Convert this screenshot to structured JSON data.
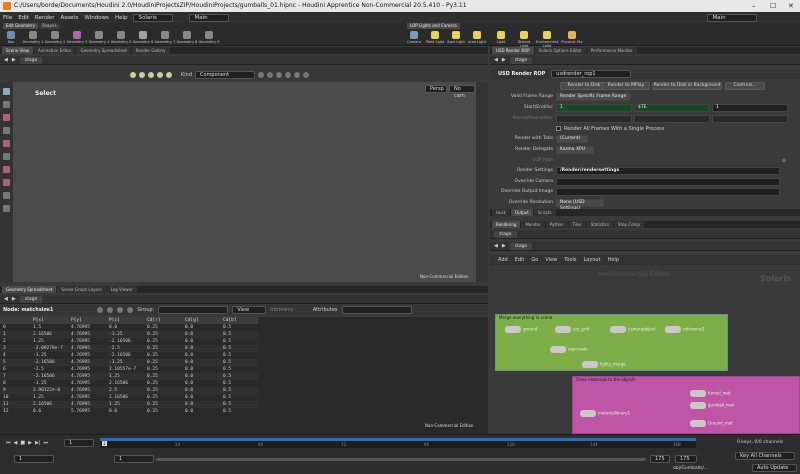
{
  "window": {
    "title": "C:/Users/borde/Documents/Houdini 2.0/HoudiniProjectsZIP/HoudiniProjects/gumballs_01.hipnc - Houdini Apprentice Non-Commercial 20.5.410 - Py3.11"
  },
  "menu": {
    "items": [
      "File",
      "Edit",
      "Render",
      "Assets",
      "Windows",
      "Help"
    ],
    "desktop": "Solaris",
    "context": "Main",
    "right_context": "Main"
  },
  "shelf": {
    "left_tabs": [
      "Edit Geometry",
      "Shapes"
    ],
    "tools": [
      "Box",
      "Geometry 1",
      "Geometry 2",
      "Geometry 3",
      "Geometry 4",
      "Geometry 5",
      "Geometry 6",
      "Geometry 7",
      "Geometry 8",
      "Geometry 9"
    ],
    "right_tabs": [
      "LOP Lights and Camera"
    ],
    "right_tools": [
      "Camera",
      "Point Light",
      "Spot Light",
      "Area Light",
      "Light",
      "Distant Light",
      "Environment Light",
      "Physical Sky"
    ]
  },
  "top_tabs": [
    "Scene View",
    "Animation Editor",
    "Geometry Spreadsheet",
    "Render Gallery"
  ],
  "right_top_tabs": [
    "USD Render ROP",
    "Solaris Options Editor",
    "Performance Monitor"
  ],
  "stage": "stage",
  "viewport": {
    "kind_label": "Kind",
    "kind_value": "Component",
    "select_label": "Select",
    "persp": "Persp",
    "cam": "No cam",
    "watermark": "Non-Commercial Edition"
  },
  "spreadsheet": {
    "tabs": [
      "Geometry Spreadsheet",
      "Scene Graph Layers",
      "Log Viewer"
    ],
    "node_label": "Node: matchsize1",
    "group_label": "Group:",
    "view_label": "View",
    "intrinsics": "Intrinsics",
    "attributes": "Attributes",
    "columns": [
      "",
      "P[x]",
      "P[y]",
      "P[z]",
      "Cd[r]",
      "Cd[g]",
      "Cd[b]"
    ],
    "rows": [
      [
        "0",
        "1.5",
        "4.76995",
        "0.0",
        "0.25",
        "0.0",
        "0.5"
      ],
      [
        "1",
        "2.16506",
        "4.76995",
        "-1.25",
        "0.25",
        "0.0",
        "0.5"
      ],
      [
        "2",
        "1.25",
        "4.76995",
        "-2.16506",
        "0.25",
        "0.0",
        "0.5"
      ],
      [
        "3",
        "-2.09278e-7",
        "4.76995",
        "-2.5",
        "0.25",
        "0.0",
        "0.5"
      ],
      [
        "4",
        "-1.25",
        "4.76995",
        "-2.16506",
        "0.25",
        "0.0",
        "0.5"
      ],
      [
        "5",
        "-2.16506",
        "4.76995",
        "-1.25",
        "0.25",
        "0.0",
        "0.5"
      ],
      [
        "6",
        "-2.5",
        "4.76995",
        "2.18557e-7",
        "0.25",
        "0.0",
        "0.5"
      ],
      [
        "7",
        "-2.16506",
        "4.76995",
        "1.25",
        "0.25",
        "0.0",
        "0.5"
      ],
      [
        "8",
        "-1.25",
        "4.76995",
        "2.16506",
        "0.25",
        "0.0",
        "0.5"
      ],
      [
        "9",
        "2.98122e-8",
        "4.76995",
        "2.5",
        "0.25",
        "0.0",
        "0.5"
      ],
      [
        "10",
        "1.25",
        "4.76995",
        "2.16506",
        "0.25",
        "0.0",
        "0.5"
      ],
      [
        "11",
        "2.16506",
        "4.76995",
        "1.25",
        "0.25",
        "0.0",
        "0.5"
      ],
      [
        "12",
        "0.6",
        "5.76995",
        "0.0",
        "0.25",
        "0.0",
        "0.5"
      ]
    ],
    "watermark": "Non-Commercial Edition"
  },
  "rop": {
    "header_type": "USD Render ROP",
    "header_name": "usdrender_rop1",
    "buttons": [
      "Render to Disk",
      "Render to MPlay",
      "Render to Disk in Background",
      "Controls..."
    ],
    "valid_frame_range_label": "Valid Frame Range",
    "valid_frame_range": "Render Specific Frame Range",
    "start_end_label": "Start/End/Inc",
    "start": "1",
    "end": "$TE",
    "inc": "1",
    "preroll_label": "Preroll/Postroll/Inc",
    "all_frames_label": "Render All Frames With a Single Process",
    "take_label": "Render with Take",
    "take": "(Current)",
    "delegate_label": "Render Delegate",
    "delegate": "Karma XPU",
    "lop_path_label": "LOP Path",
    "settings_label": "Render Settings",
    "settings": "/Render/rendersettings",
    "override_camera_label": "Override Camera",
    "override_output_label": "Override Output Image",
    "override_res_label": "Override Resolution",
    "override_res": "None (USD Settings)",
    "subtabs": [
      "Husk",
      "Output",
      "Scripts"
    ],
    "bottom_tabs": [
      "Rendering",
      "Monitor",
      "Python",
      "Tiles",
      "Statistics",
      "Stop Comp"
    ]
  },
  "network": {
    "path": "stage",
    "menu": [
      "Add",
      "Edit",
      "Go",
      "View",
      "Tools",
      "Layout",
      "Help"
    ],
    "watermark": "Non-Commercial Edition",
    "context_label": "Solaris",
    "box1": "Merge everything in scene",
    "box2": "Glass materials to the objects",
    "nodes": [
      "ground",
      "cat_grid",
      "cameraobject",
      "reference1",
      "sopcreate",
      "lights_merge",
      "materiallibrary1",
      "funnel_mat",
      "gumball_mat",
      "Ground_mat"
    ]
  },
  "timeline": {
    "ticks": [
      "1",
      "24",
      "48",
      "72",
      "96",
      "120",
      "144",
      "168"
    ],
    "frame": "1",
    "start": "1",
    "end": "1",
    "end2": "175",
    "end3": "175",
    "keys": "0 keys, 0/0 channels",
    "key_all": "Key All Channels",
    "auto": "Auto Update",
    "file": "obj/Gumballs/..."
  }
}
